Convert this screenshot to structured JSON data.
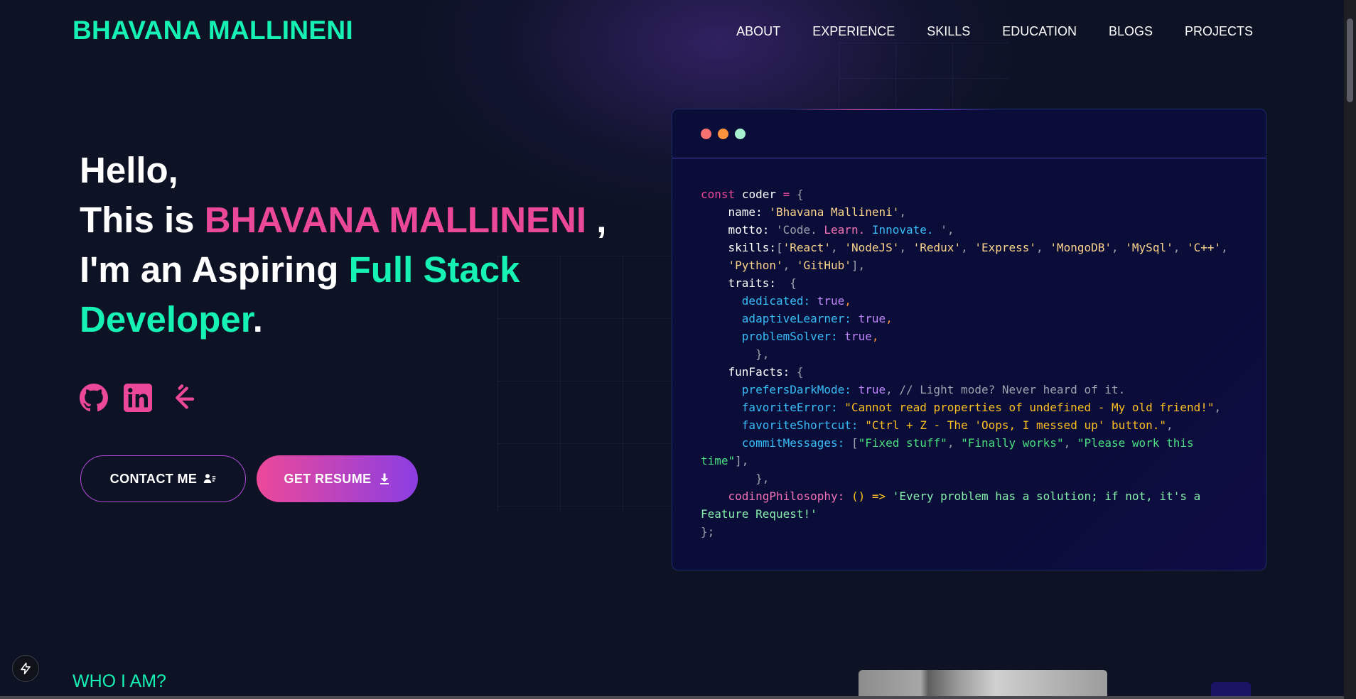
{
  "brand": "BHAVANA MALLINENI",
  "nav": [
    "ABOUT",
    "EXPERIENCE",
    "SKILLS",
    "EDUCATION",
    "BLOGS",
    "PROJECTS"
  ],
  "hero": {
    "line1": "Hello,",
    "line2_prefix": "This is ",
    "name": "BHAVANA MALLINENI",
    "line2_suffix": " ,",
    "line3_prefix": "I'm an Aspiring ",
    "role": "Full Stack Developer",
    "line3_suffix": "."
  },
  "socials": [
    {
      "name": "github",
      "icon": "github-icon"
    },
    {
      "name": "linkedin",
      "icon": "linkedin-icon"
    },
    {
      "name": "leetcode",
      "icon": "leetcode-icon"
    }
  ],
  "buttons": {
    "contact": "CONTACT ME",
    "resume": "GET RESUME"
  },
  "code": {
    "dots": [
      "#f87171",
      "#fb923c",
      "#a7f3d0"
    ],
    "kw_const": "const",
    "var_name": "coder",
    "name_key": "name:",
    "name_val": "'Bhavana Mallineni'",
    "motto_key": "motto:",
    "motto_val_code": "'Code.",
    "motto_val_learn": "Learn.",
    "motto_val_innovate": "Innovate.",
    "motto_val_end": "'",
    "skills_key": "skills:",
    "skills": [
      "'React'",
      "'NodeJS'",
      "'Redux'",
      "'Express'",
      "'MongoDB'",
      "'MySql'",
      "'C++'",
      "'Python'",
      "'GitHub'"
    ],
    "traits_key": "traits:",
    "trait_keys": [
      "dedicated:",
      "adaptiveLearner:",
      "problemSolver:"
    ],
    "true_val": "true",
    "funfacts_key": "funFacts:",
    "dark_key": "prefersDarkMode:",
    "dark_comment": "// Light mode? Never heard of it.",
    "error_key": "favoriteError:",
    "error_val": "\"Cannot read properties of undefined - My old friend!\"",
    "shortcut_key": "favoriteShortcut:",
    "shortcut_val": "\"Ctrl + Z - The 'Oops, I messed up' button.\"",
    "commit_key": "commitMessages:",
    "commit_vals": [
      "\"Fixed stuff\"",
      "\"Finally works\"",
      "\"Please work this",
      "time\""
    ],
    "philosophy_key": "codingPhilosophy:",
    "philosophy_arrow": "() =>",
    "philosophy_val_1": "'Every problem has a solution; if not, it's a",
    "philosophy_val_2": "Feature Request!'"
  },
  "section_title": "WHO I AM?",
  "colors": {
    "accent_green": "#16f2b3",
    "accent_pink": "#ec4899",
    "accent_purple": "#8b3ee3",
    "background": "#0d1224"
  }
}
